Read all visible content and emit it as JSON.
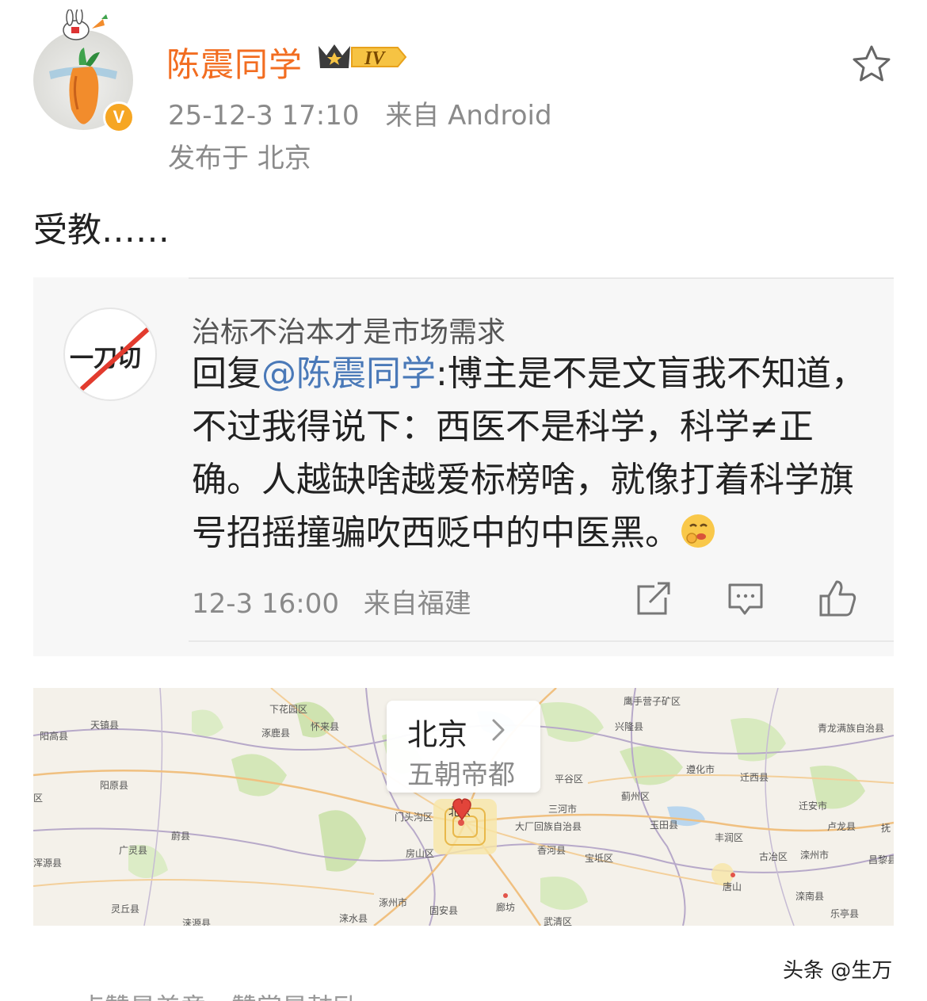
{
  "post": {
    "username": "陈震同学",
    "level_badge": "IV",
    "verified_badge": "V",
    "timestamp": "25-12-3 17:10",
    "source": "来自 Android",
    "location": "发布于 北京",
    "text": "受教……"
  },
  "reply": {
    "avatar_text": "一刀切",
    "author": "治标不治本才是市场需求",
    "prefix": "回复",
    "mention": "@陈震同学",
    "text_rest": ":博主是不是文盲我不知道，不过我得说下：西医不是科学，科学≠正确。人越缺啥越爱标榜啥，就像打着科学旗号招摇撞骗吹西贬中的中医黑。",
    "timestamp": "12-3 16:00",
    "source": "来自福建"
  },
  "map": {
    "city": "北京",
    "tagline": "五朝帝都",
    "labels": [
      "天镇县",
      "阳高县",
      "下花园区",
      "涿鹿县",
      "怀来县",
      "鹰手营子矿区",
      "兴隆县",
      "青龙满族自治县",
      "阳原县",
      "区",
      "平谷区",
      "遵化市",
      "迁西县",
      "蓟州区",
      "北京",
      "门头沟区",
      "三河市",
      "迁安市",
      "卢龙县",
      "蔚县",
      "大厂回族自治县",
      "玉田县",
      "丰润区",
      "抚",
      "广灵县",
      "房山区",
      "香河县",
      "宝坻区",
      "古冶区",
      "滦州市",
      "昌黎县",
      "浑源县",
      "唐山",
      "涿州市",
      "固安县",
      "廊坊",
      "滦南县",
      "灵丘县",
      "涞水县",
      "武清区",
      "乐亭县",
      "涞源县"
    ]
  },
  "footer": {
    "watermark": "头条 @生万",
    "cut_off_text": "点赞是美意，赞赏是鼓励"
  },
  "colors": {
    "username": "#f26d21",
    "mention": "#4a79b8",
    "meta": "#8a8a8a",
    "badge": "#f6a623"
  }
}
